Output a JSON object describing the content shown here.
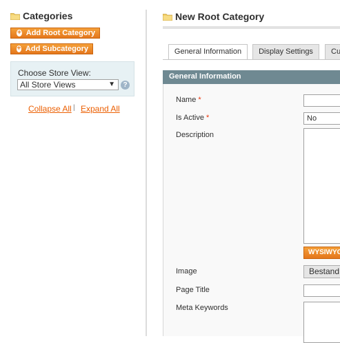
{
  "sidebar": {
    "title": "Categories",
    "add_root_label": "Add Root Category",
    "add_sub_label": "Add Subcategory",
    "store_view_label": "Choose Store View:",
    "store_view_value": "All Store Views",
    "help_glyph": "?",
    "collapse_all": "Collapse All",
    "separator": "|",
    "expand_all": "Expand All"
  },
  "main": {
    "title": "New Root Category",
    "tabs": [
      {
        "label": "General Information",
        "active": true
      },
      {
        "label": "Display Settings",
        "active": false
      },
      {
        "label": "Cu",
        "active": false
      }
    ],
    "section_title": "General Information",
    "fields": {
      "name_label": "Name",
      "is_active_label": "Is Active",
      "is_active_value": "No",
      "description_label": "Description",
      "wysiwyg_label": "WYSIWYG",
      "image_label": "Image",
      "image_button": "Bestand",
      "page_title_label": "Page Title",
      "meta_keywords_label": "Meta Keywords",
      "required_mark": "*"
    }
  },
  "colors": {
    "accent_orange": "#e4761c",
    "section_header": "#6f8992",
    "link_orange": "#eb5e00",
    "required_red": "#eb340a"
  },
  "icons": [
    "folder-icon",
    "plus-icon",
    "help-icon",
    "chevron-down-icon"
  ]
}
